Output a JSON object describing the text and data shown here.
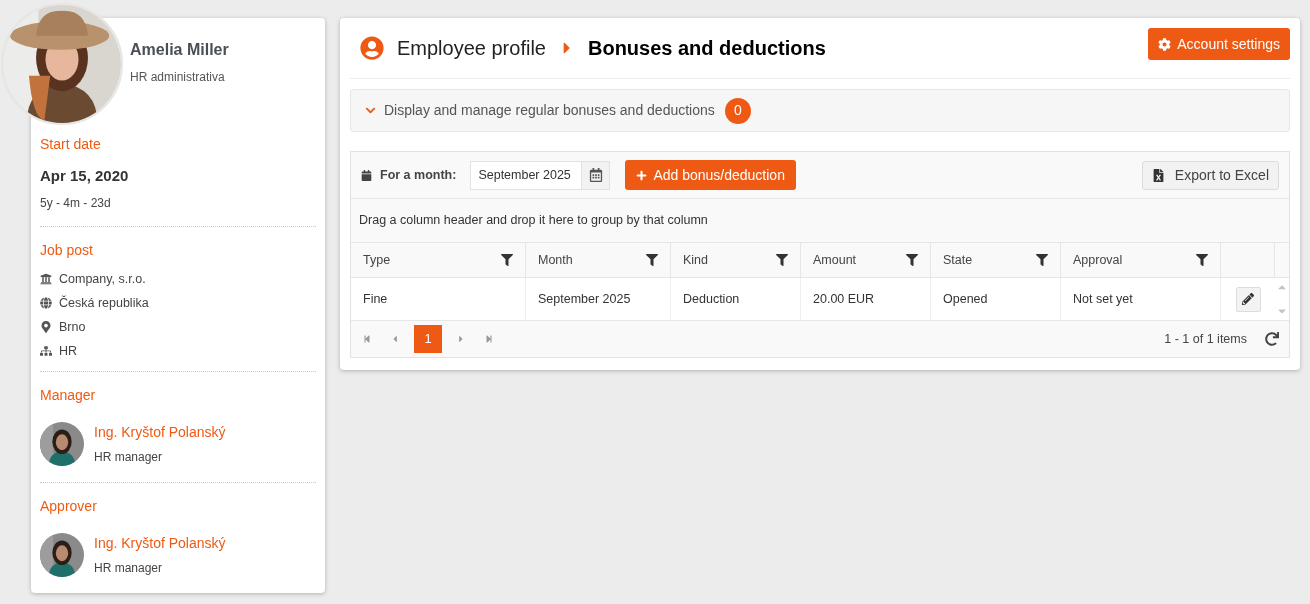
{
  "profile": {
    "name": "Amelia Miller",
    "role": "HR administrativa"
  },
  "start_date": {
    "label": "Start date",
    "date": "Apr 15, 2020",
    "duration": "5y - 4m - 23d"
  },
  "job_post": {
    "label": "Job post",
    "items": [
      {
        "kind": "company",
        "text": "Company, s.r.o."
      },
      {
        "kind": "country",
        "text": "Česká republika"
      },
      {
        "kind": "city",
        "text": "Brno"
      },
      {
        "kind": "department",
        "text": "HR"
      }
    ]
  },
  "people": [
    {
      "label": "Manager",
      "name": "Ing. Kryštof Polanský",
      "role": "HR manager"
    },
    {
      "label": "Approver",
      "name": "Ing. Kryštof Polanský",
      "role": "HR manager"
    }
  ],
  "header": {
    "parent": "Employee profile",
    "current": "Bonuses and deductions",
    "account_button": "Account settings"
  },
  "accordion": {
    "label": "Display and manage regular bonuses and deductions",
    "count": "0",
    "expanded": false
  },
  "toolbar": {
    "month_label": "For a month:",
    "month_value": "September 2025",
    "add_button": "Add bonus/deduction",
    "export_button": "Export to Excel"
  },
  "group_hint": "Drag a column header and drop it here to group by that column",
  "table": {
    "columns": [
      "Type",
      "Month",
      "Kind",
      "Amount",
      "State",
      "Approval"
    ],
    "rows": [
      {
        "cells": [
          "Fine",
          "September 2025",
          "Deduction",
          "20.00 EUR",
          "Opened",
          "Not set yet"
        ]
      }
    ]
  },
  "pager": {
    "pages": [
      {
        "label": "1",
        "selected": true
      }
    ],
    "summary": "1 - 1 of 1 items"
  }
}
